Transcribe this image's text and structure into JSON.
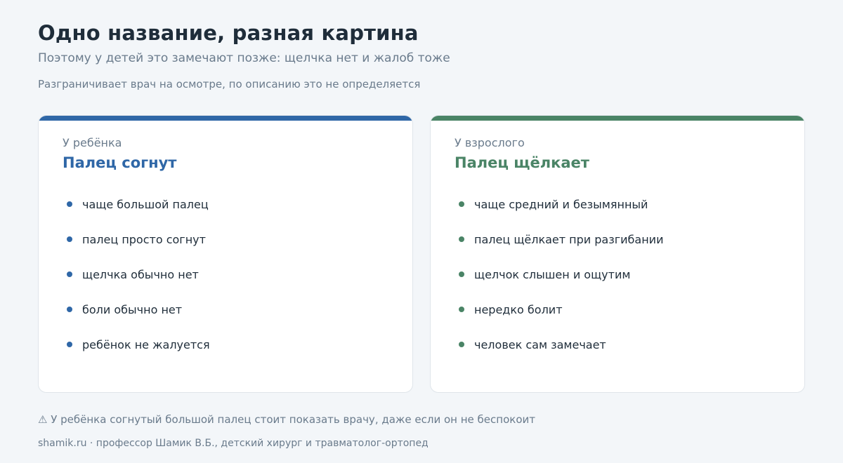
{
  "header": {
    "title": "Одно название, разная картина",
    "subtitle": "Поэтому у детей это замечают позже: щелчка нет и жалоб тоже",
    "note": "Разграничивает врач на осмотре, по описанию это не определяется"
  },
  "cards": {
    "child": {
      "kicker": "У ребёнка",
      "heading": "Палец согнут",
      "accent": "#2f67a7",
      "items": [
        "чаще большой палец",
        "палец просто согнут",
        "щелчка обычно нет",
        "боли обычно нет",
        "ребёнок не жалуется"
      ]
    },
    "adult": {
      "kicker": "У взрослого",
      "heading": "Палец щёлкает",
      "accent": "#4a8466",
      "items": [
        "чаще средний и безымянный",
        "палец щёлкает при разгибании",
        "щелчок слышен и ощутим",
        "нередко болит",
        "человек сам замечает"
      ]
    }
  },
  "warning": {
    "icon": "warning-icon",
    "symbol": "⚠",
    "text": "У ребёнка согнутый большой палец стоит показать врачу, даже если он не беспокоит"
  },
  "footer": {
    "text": "shamik.ru · профессор Шамик В.Б., детский хирург и травматолог-ортопед"
  }
}
